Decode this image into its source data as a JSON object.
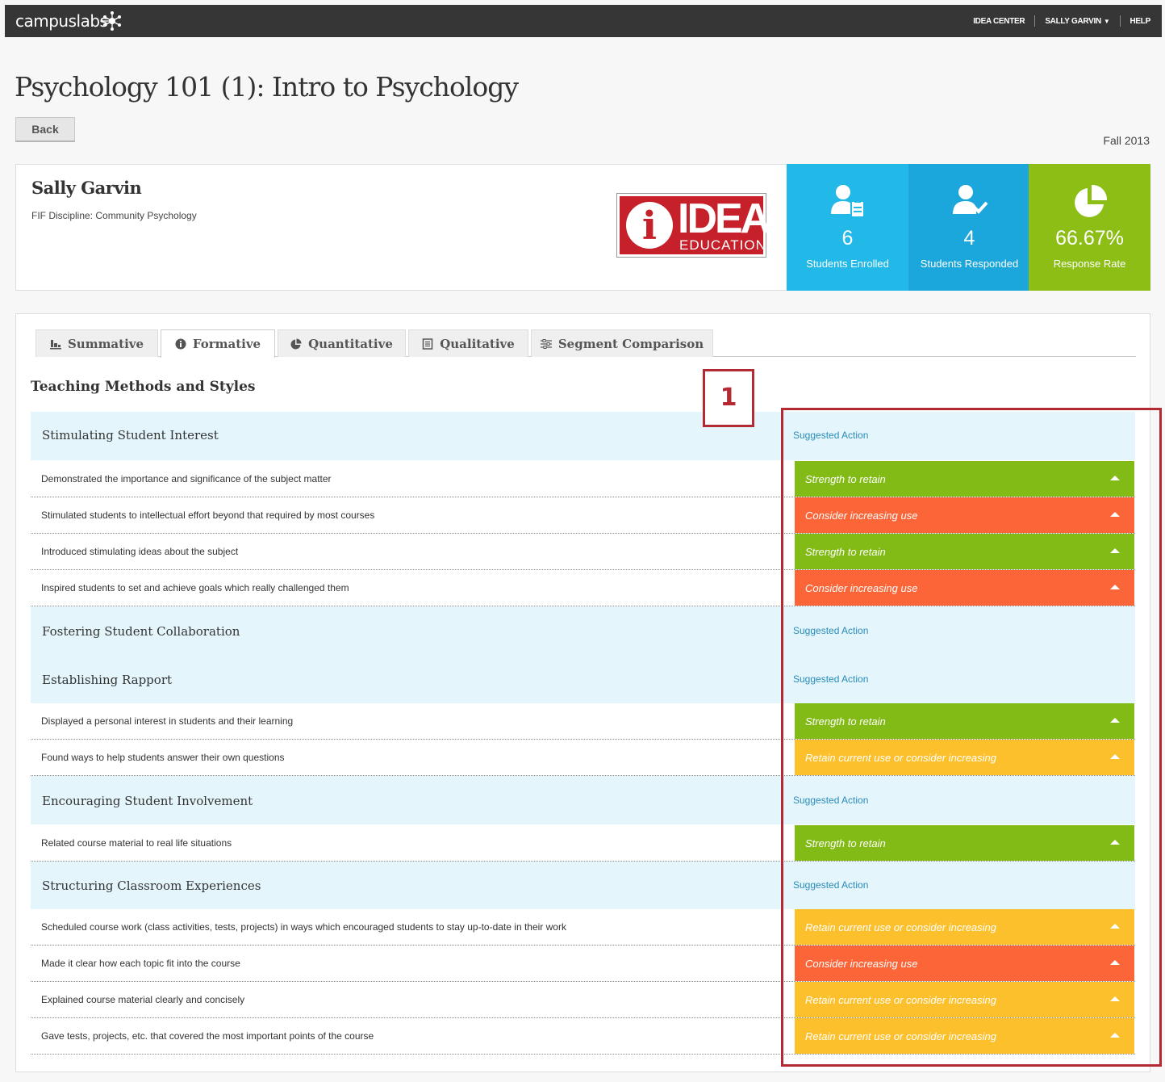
{
  "topbar": {
    "brand": "campuslabs",
    "nav": {
      "idea_center": "IDEA CENTER",
      "user": "SALLY GARVIN",
      "help": "HELP"
    }
  },
  "page": {
    "title": "Psychology 101 (1): Intro to Psychology",
    "back_label": "Back",
    "term": "Fall 2013"
  },
  "instructor": {
    "name": "Sally Garvin",
    "discipline": "FIF Discipline: Community Psychology"
  },
  "logo": {
    "mark": "i",
    "word": "IDEA",
    "sub": "EDUCATION"
  },
  "stats": [
    {
      "value": "6",
      "label": "Students Enrolled",
      "color": "#22b9e8",
      "icon": "enrolled-students-icon"
    },
    {
      "value": "4",
      "label": "Students Responded",
      "color": "#1ba6dc",
      "icon": "responded-students-icon"
    },
    {
      "value": "66.67%",
      "label": "Response Rate",
      "color": "#8cbe16",
      "icon": "pie-chart-icon"
    }
  ],
  "tabs": [
    {
      "label": "Summative",
      "icon": "bar-chart-icon"
    },
    {
      "label": "Formative",
      "icon": "info-icon",
      "active": true
    },
    {
      "label": "Quantitative",
      "icon": "pie-chart-icon"
    },
    {
      "label": "Qualitative",
      "icon": "document-icon"
    },
    {
      "label": "Segment Comparison",
      "icon": "sliders-icon"
    }
  ],
  "section_title": "Teaching Methods and Styles",
  "colors": {
    "strength": "#82bb16",
    "consider": "#fb6538",
    "retain": "#fdc02d",
    "accent": "#b32a33"
  },
  "groups": [
    {
      "name": "Stimulating Student Interest",
      "action_header": "Suggested Action",
      "items": [
        {
          "text": "Demonstrated the importance and significance of the subject matter",
          "action": "Strength to retain",
          "kind": "strength"
        },
        {
          "text": "Stimulated students to intellectual effort beyond that required by most courses",
          "action": "Consider increasing use",
          "kind": "consider"
        },
        {
          "text": "Introduced stimulating ideas about the subject",
          "action": "Strength to retain",
          "kind": "strength"
        },
        {
          "text": "Inspired students to set and achieve goals which really challenged them",
          "action": "Consider increasing use",
          "kind": "consider"
        }
      ]
    },
    {
      "name": "Fostering Student Collaboration",
      "action_header": "Suggested Action",
      "items": []
    },
    {
      "name": "Establishing Rapport",
      "action_header": "Suggested Action",
      "items": [
        {
          "text": "Displayed a personal interest in students and their learning",
          "action": "Strength to retain",
          "kind": "strength"
        },
        {
          "text": "Found ways to help students answer their own questions",
          "action": "Retain current use or consider increasing",
          "kind": "retain"
        }
      ]
    },
    {
      "name": "Encouraging Student Involvement",
      "action_header": "Suggested Action",
      "items": [
        {
          "text": "Related course material to real life situations",
          "action": "Strength to retain",
          "kind": "strength"
        }
      ]
    },
    {
      "name": "Structuring Classroom Experiences",
      "action_header": "Suggested Action",
      "items": [
        {
          "text": "Scheduled course work (class activities, tests, projects) in ways which encouraged students to stay up-to-date in their work",
          "action": "Retain current use or consider increasing",
          "kind": "retain"
        },
        {
          "text": "Made it clear how each topic fit into the course",
          "action": "Consider increasing use",
          "kind": "consider"
        },
        {
          "text": "Explained course material clearly and concisely",
          "action": "Retain current use or consider increasing",
          "kind": "retain"
        },
        {
          "text": "Gave tests, projects, etc. that covered the most important points of the course",
          "action": "Retain current use or consider increasing",
          "kind": "retain"
        }
      ]
    }
  ],
  "callout": {
    "number": "1"
  }
}
